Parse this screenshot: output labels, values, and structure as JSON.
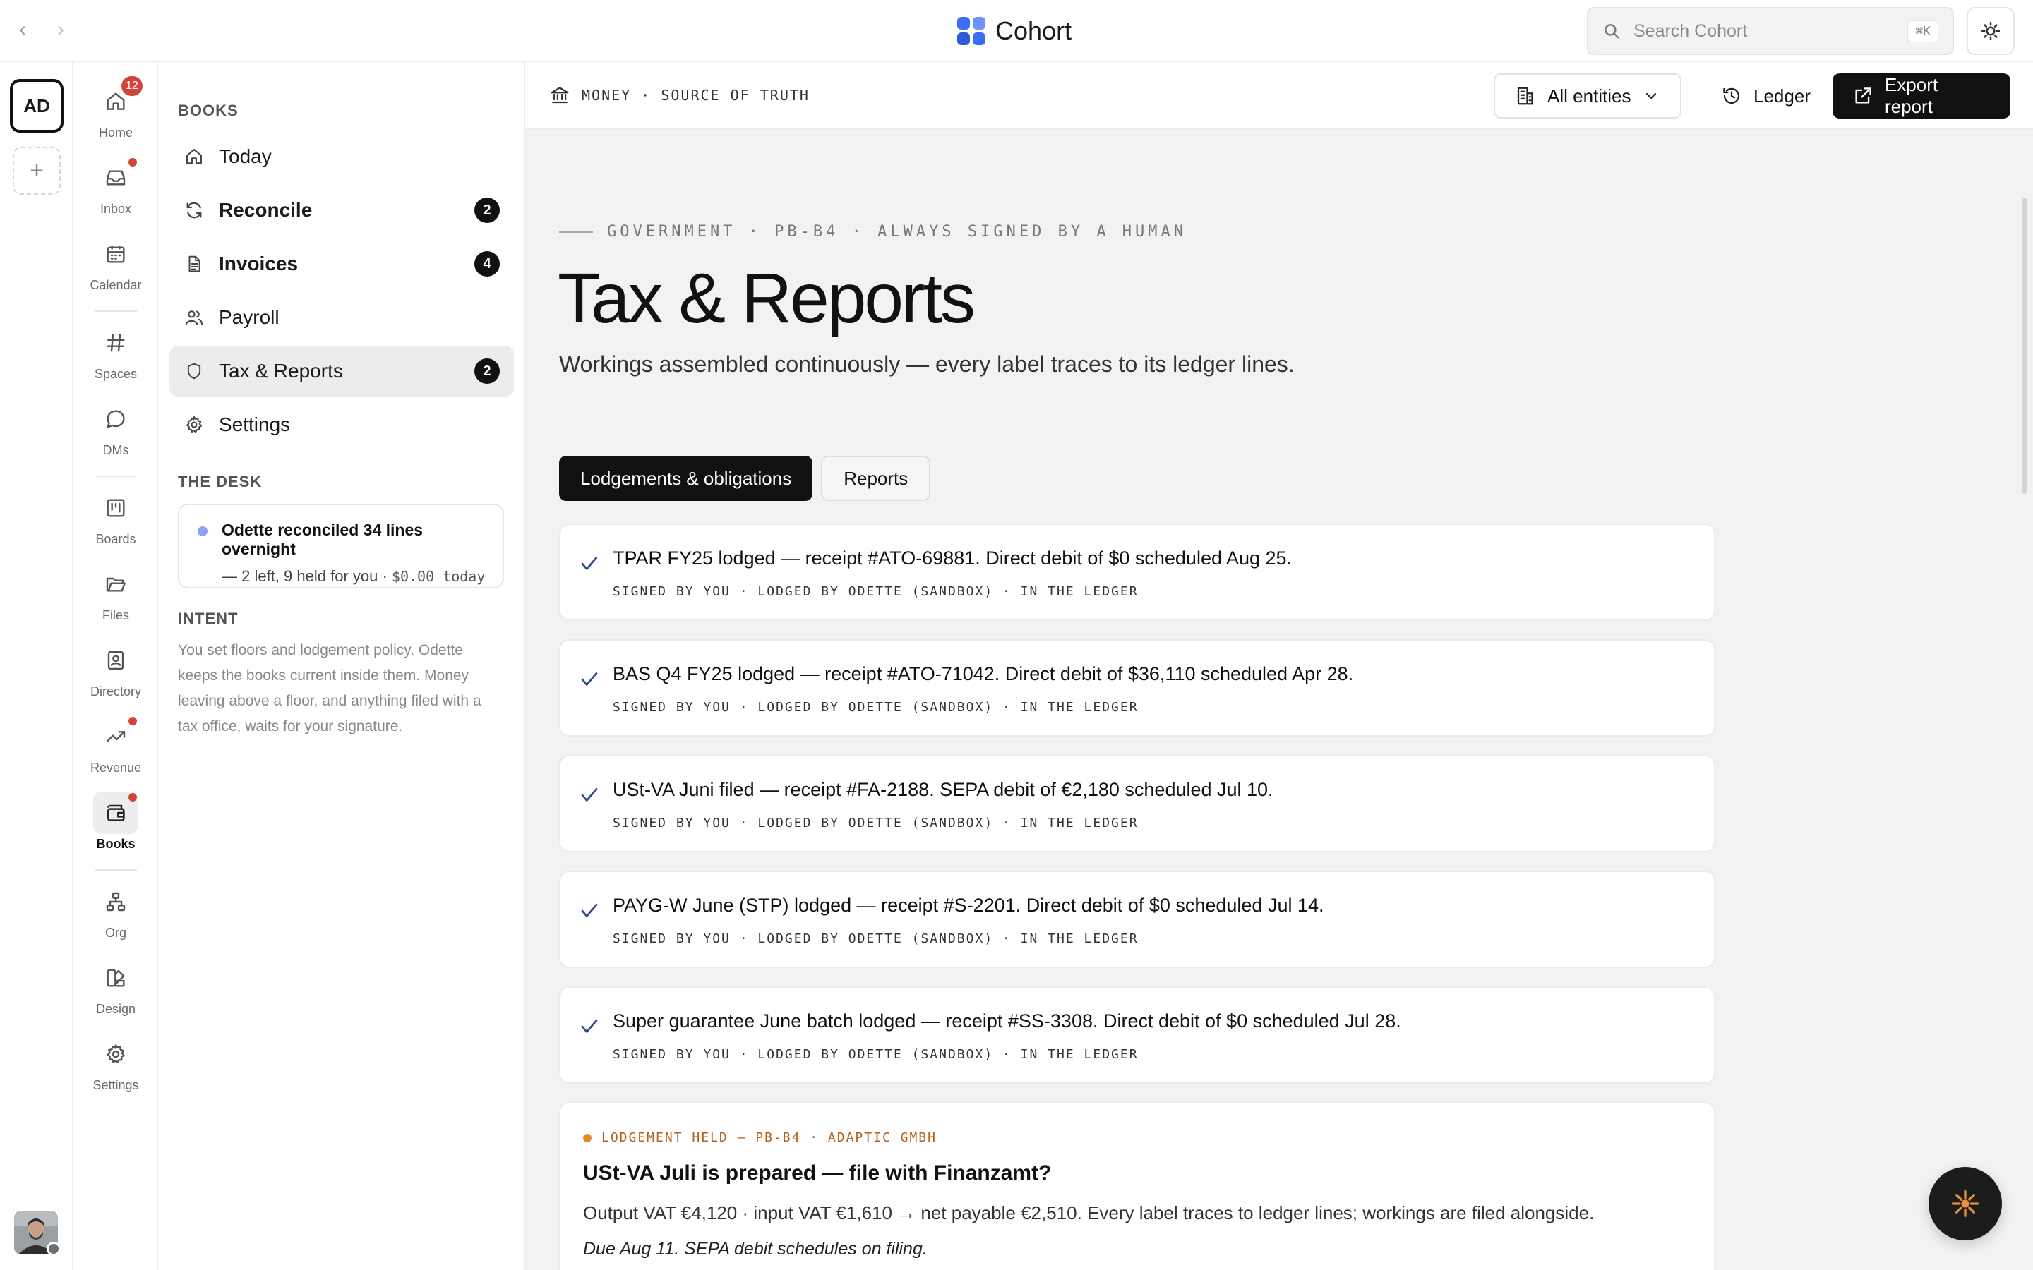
{
  "app": {
    "name": "Cohort"
  },
  "topbar": {
    "back": "‹",
    "forward": "›",
    "search_placeholder": "Search Cohort",
    "search_shortcut": "⌘K"
  },
  "workspace": {
    "initials": "AD",
    "add": "+"
  },
  "nav": {
    "items": [
      {
        "label": "Home",
        "icon": "home-icon",
        "badge": "12"
      },
      {
        "label": "Inbox",
        "icon": "inbox-icon",
        "dot": true
      },
      {
        "label": "Calendar",
        "icon": "calendar-icon"
      },
      {
        "label": "Spaces",
        "icon": "hash-icon"
      },
      {
        "label": "DMs",
        "icon": "chat-icon"
      },
      {
        "label": "Boards",
        "icon": "board-icon"
      },
      {
        "label": "Files",
        "icon": "folder-icon"
      },
      {
        "label": "Directory",
        "icon": "contact-book-icon"
      },
      {
        "label": "Revenue",
        "icon": "trend-up-icon",
        "dot": true
      },
      {
        "label": "Books",
        "icon": "wallet-icon",
        "dot": true,
        "active": true
      },
      {
        "label": "Org",
        "icon": "org-chart-icon"
      },
      {
        "label": "Design",
        "icon": "design-icon"
      },
      {
        "label": "Settings",
        "icon": "gear-icon"
      }
    ]
  },
  "sidebar": {
    "section_books": "BOOKS",
    "items": [
      {
        "label": "Today",
        "icon": "home-icon"
      },
      {
        "label": "Reconcile",
        "icon": "refresh-icon",
        "badge": "2"
      },
      {
        "label": "Invoices",
        "icon": "document-icon",
        "badge": "4"
      },
      {
        "label": "Payroll",
        "icon": "people-icon"
      },
      {
        "label": "Tax & Reports",
        "icon": "shield-icon",
        "badge": "2"
      },
      {
        "label": "Settings",
        "icon": "gear-icon"
      }
    ],
    "section_desk": "THE DESK",
    "desk_card": {
      "title": "Odette reconciled 34 lines overnight",
      "sub": "— 2 left, 9 held for you ·",
      "amount": "$0.00 today"
    },
    "section_intent": "INTENT",
    "intent_text": "You set floors and lodgement policy. Odette keeps the books current inside them. Money leaving above a floor, and anything filed with a tax office, waits for your signature."
  },
  "main": {
    "breadcrumb": "MONEY · SOURCE OF TRUTH",
    "entities_button": "All entities",
    "ledger_button": "Ledger",
    "export_button": "Export report",
    "eyebrow": "GOVERNMENT · PB-B4 · ALWAYS SIGNED BY A HUMAN",
    "title": "Tax & Reports",
    "subtitle": "Workings assembled continuously — every label traces to its ledger lines.",
    "tabs": [
      {
        "label": "Lodgements & obligations",
        "active": true
      },
      {
        "label": "Reports",
        "active": false
      }
    ],
    "lodgements": [
      {
        "title": "TPAR FY25 lodged — receipt #ATO-69881. Direct debit of $0 scheduled Aug 25.",
        "meta": "SIGNED BY YOU · LODGED BY ODETTE (SANDBOX) · IN THE LEDGER"
      },
      {
        "title": "BAS Q4 FY25 lodged — receipt #ATO-71042. Direct debit of $36,110 scheduled Apr 28.",
        "meta": "SIGNED BY YOU · LODGED BY ODETTE (SANDBOX) · IN THE LEDGER"
      },
      {
        "title": "USt-VA Juni filed — receipt #FA-2188. SEPA debit of €2,180 scheduled Jul 10.",
        "meta": "SIGNED BY YOU · LODGED BY ODETTE (SANDBOX) · IN THE LEDGER"
      },
      {
        "title": "PAYG-W June (STP) lodged — receipt #S-2201. Direct debit of $0 scheduled Jul 14.",
        "meta": "SIGNED BY YOU · LODGED BY ODETTE (SANDBOX) · IN THE LEDGER"
      },
      {
        "title": "Super guarantee June batch lodged — receipt #SS-3308. Direct debit of $0 scheduled Jul 28.",
        "meta": "SIGNED BY YOU · LODGED BY ODETTE (SANDBOX) · IN THE LEDGER"
      }
    ],
    "held": {
      "tag": "LODGEMENT HELD — PB-B4 · ADAPTIC GMBH",
      "title": "USt-VA Juli is prepared — file with Finanzamt?",
      "body": "Output VAT €4,120 · input VAT €1,610 → net payable €2,510. Every label traces to ledger lines; workings are filed alongside.",
      "due": "Due Aug 11. SEPA debit schedules on filing."
    }
  },
  "colors": {
    "accent": "#111111",
    "badge_red": "#d0443a",
    "brand_blue": "#3b6ef5",
    "held_orange": "#e08a2c",
    "check_blue": "#2f4a8a"
  }
}
